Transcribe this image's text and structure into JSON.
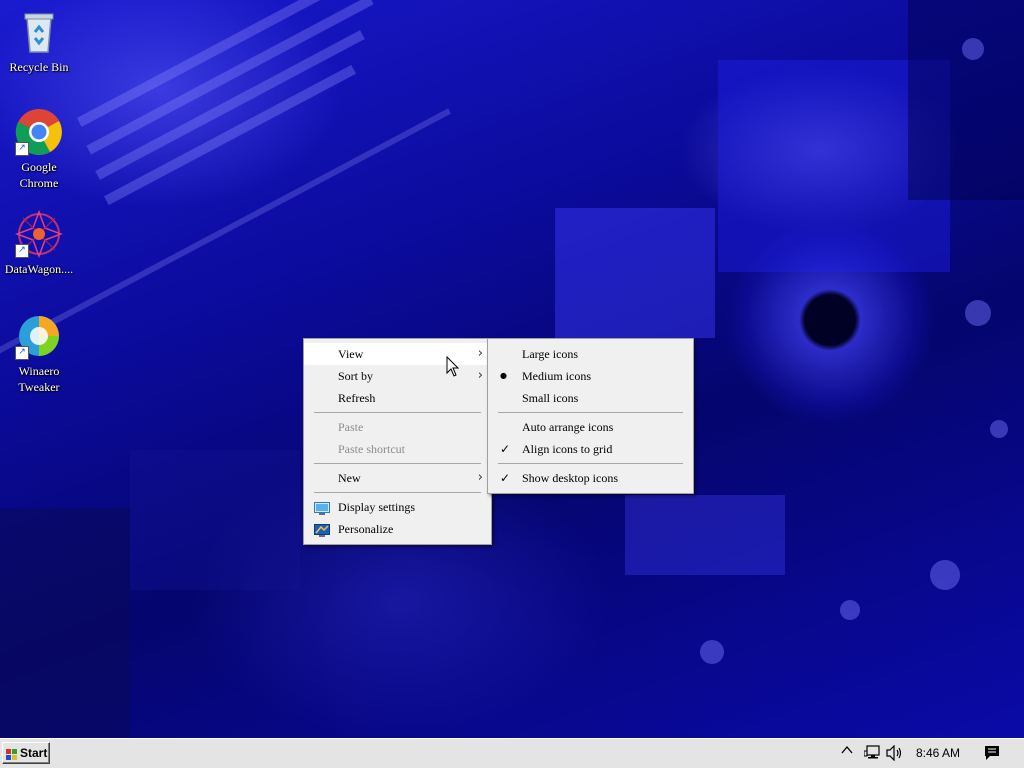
{
  "desktop": {
    "icons": [
      {
        "label": "Recycle Bin",
        "icon": "recycle-bin-icon"
      },
      {
        "label": "Google Chrome",
        "icon": "chrome-icon"
      },
      {
        "label": "DataWagon....",
        "icon": "datawagon-icon"
      },
      {
        "label": "Winaero Tweaker",
        "icon": "winaero-icon"
      }
    ]
  },
  "context_menu": {
    "items": {
      "view": "View",
      "sort_by": "Sort by",
      "refresh": "Refresh",
      "paste": "Paste",
      "paste_shortcut": "Paste shortcut",
      "new": "New",
      "display_settings": "Display settings",
      "personalize": "Personalize"
    },
    "submenu_arrow": "›"
  },
  "view_submenu": {
    "large_icons": "Large icons",
    "medium_icons": "Medium icons",
    "small_icons": "Small icons",
    "auto_arrange": "Auto arrange icons",
    "align_to_grid": "Align icons to grid",
    "show_desktop_icons": "Show desktop icons",
    "radio_mark": "●",
    "check_mark": "✓"
  },
  "taskbar": {
    "start_label": "Start",
    "clock": "8:46 AM",
    "tray_chevron": "^"
  },
  "colors": {
    "wallpaper": "#0b0b9c",
    "menu_bg": "#f0f0f0",
    "taskbar_bg": "#e4e4e4"
  }
}
